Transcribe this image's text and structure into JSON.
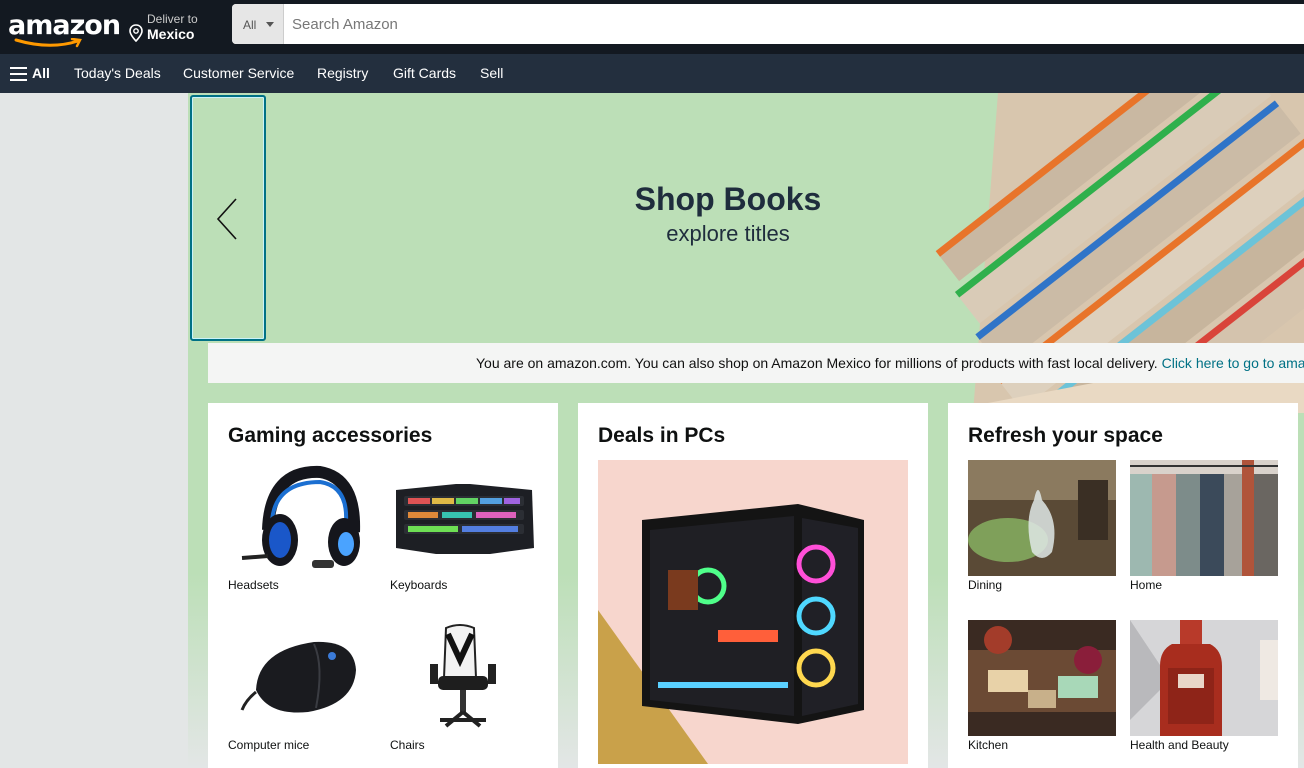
{
  "header": {
    "logo_text": "amazon",
    "deliver_line1": "Deliver to",
    "deliver_line2": "Mexico",
    "search_category": "All",
    "search_placeholder": "Search Amazon"
  },
  "nav": {
    "all_label": "All",
    "links": [
      "Today's Deals",
      "Customer Service",
      "Registry",
      "Gift Cards",
      "Sell"
    ]
  },
  "hero": {
    "title": "Shop Books",
    "subtitle": "explore titles"
  },
  "notice": {
    "message": "You are on amazon.com. You can also shop on Amazon Mexico for millions of products with fast local delivery. ",
    "link": "Click here to go to amazon.com.mx"
  },
  "cards": [
    {
      "title": "Gaming accessories",
      "tiles": [
        "Headsets",
        "Keyboards",
        "Computer mice",
        "Chairs"
      ]
    },
    {
      "title": "Deals in PCs"
    },
    {
      "title": "Refresh your space",
      "tiles": [
        "Dining",
        "Home",
        "Kitchen",
        "Health and Beauty"
      ]
    }
  ],
  "colors": {
    "nav_top": "#131921",
    "nav_main": "#232f3e",
    "hero_green": "#bcdfb7",
    "link": "#007185",
    "logo_smile": "#ff9900"
  }
}
